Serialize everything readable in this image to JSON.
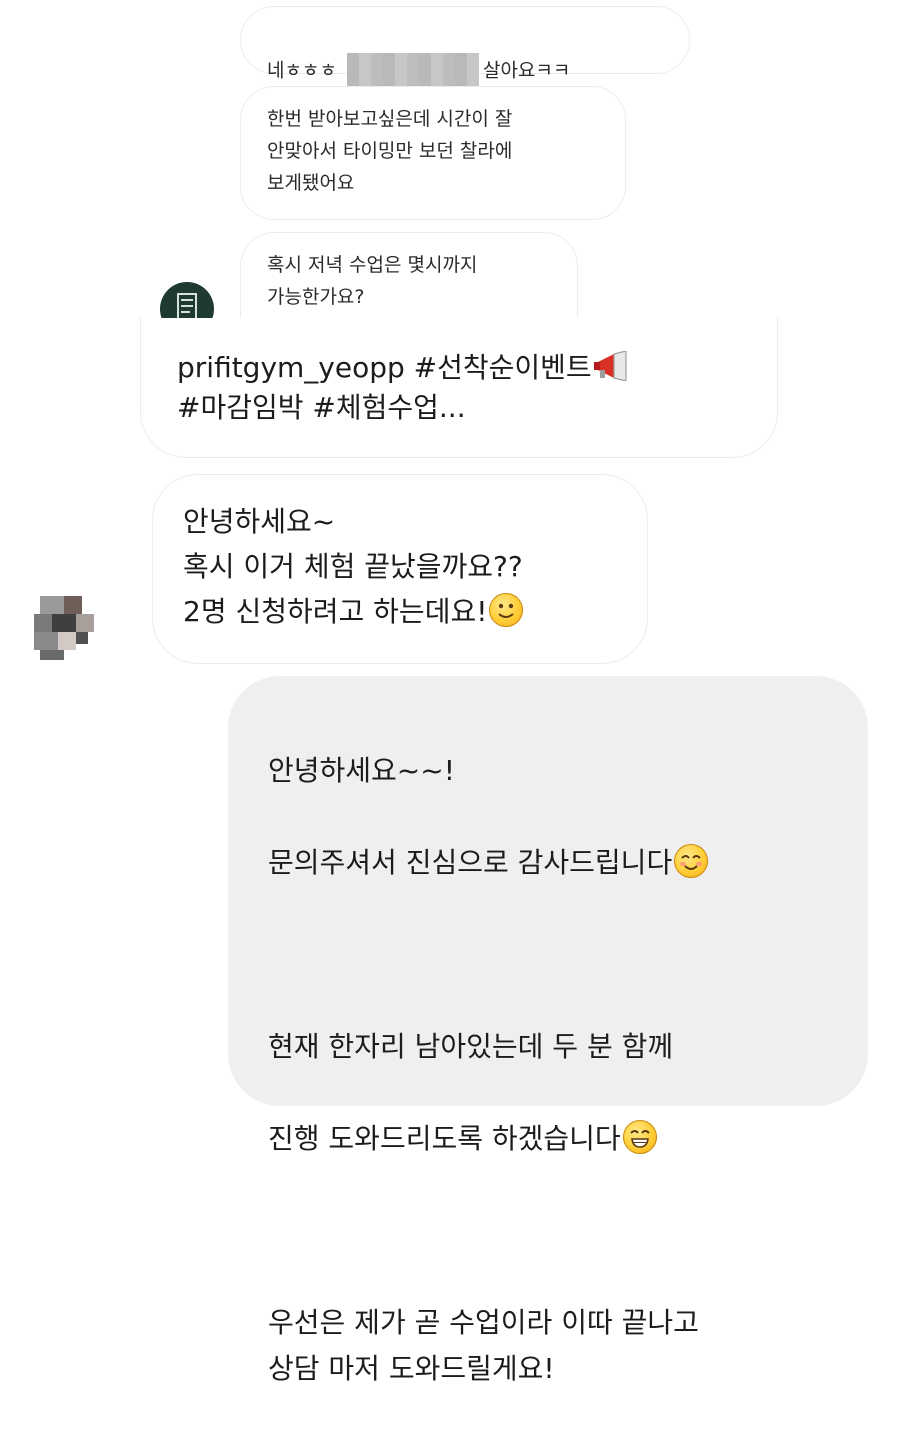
{
  "messages": [
    {
      "id": "m1",
      "direction": "in",
      "text_before": "네ㅎㅎㅎ ",
      "text_after": "살아요ㅋㅋ"
    },
    {
      "id": "m2",
      "direction": "in",
      "text": "한번 받아보고싶은데 시간이 잘\n안맞아서 타이밍만 보던 찰라에\n보게됐어요"
    },
    {
      "id": "m3",
      "direction": "in",
      "text": "혹시 저녁 수업은 몇시까지\n가능한가요?"
    },
    {
      "id": "story",
      "direction": "in",
      "line1": "prifitgym_yeopp #선착순이벤트",
      "line2": "#마감임박 #체험수업..."
    },
    {
      "id": "m4",
      "direction": "in",
      "text": "안녕하세요~\n혹시 이거 체험 끝났을까요??\n2명 신청하려고 하는데요!"
    },
    {
      "id": "m5",
      "direction": "out",
      "p1a": "안녕하세요~~!",
      "p1b": "문의주셔서 진심으로 감사드립니다",
      "p2a": "현재 한자리 남아있는데 두 분 함께",
      "p2b": "진행 도와드리도록 하겠습니다",
      "p3": "우선은 제가 곧 수업이라 이따 끝나고\n상담 마저 도와드릴게요!"
    }
  ],
  "icons": {
    "megaphone": "megaphone-icon",
    "smile": "slightly-smiling-face-icon",
    "blush": "smiling-face-icon",
    "grin": "grinning-face-icon"
  },
  "colors": {
    "incoming_bg": "#ffffff",
    "outgoing_bg": "#efefef",
    "border": "#ececec",
    "gym_avatar": "#1f3a33"
  }
}
